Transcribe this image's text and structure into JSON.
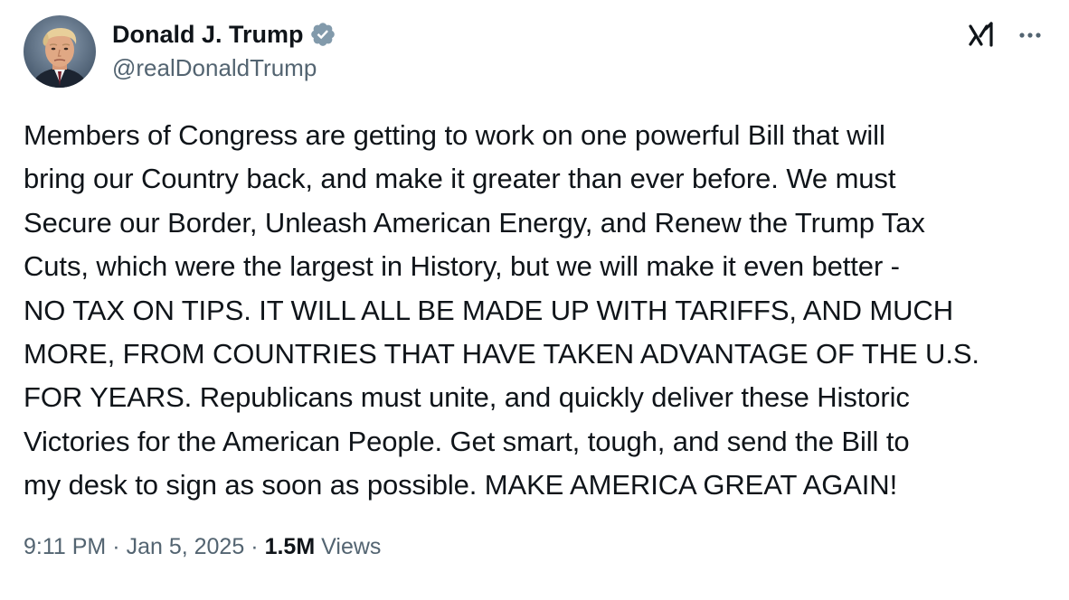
{
  "author": {
    "display_name": "Donald J. Trump",
    "handle": "@realDonaldTrump",
    "verified_badge_color": "#829aab"
  },
  "header_actions": {
    "grok_icon": "grok-icon",
    "more_icon": "more-icon"
  },
  "tweet": {
    "lines": [
      "Members of Congress are getting to work on one powerful Bill that will",
      "bring our Country back, and make it greater than ever before. We must",
      "Secure our Border, Unleash American Energy, and Renew the Trump Tax",
      "Cuts, which were the largest in History, but we will make it even better -",
      "NO TAX ON TIPS. IT WILL ALL BE MADE UP WITH TARIFFS, AND MUCH",
      "MORE, FROM COUNTRIES THAT HAVE TAKEN ADVANTAGE OF THE U.S.",
      "FOR YEARS. Republicans must unite, and quickly deliver these Historic",
      "Victories for the American People. Get smart, tough, and send the Bill to",
      "my desk to sign as soon as possible. MAKE AMERICA GREAT AGAIN!"
    ]
  },
  "meta": {
    "time": "9:11 PM",
    "separator": "·",
    "date": "Jan 5, 2025",
    "views_count": "1.5M",
    "views_label": "Views"
  },
  "colors": {
    "text_primary": "#0f1419",
    "text_secondary": "#536471"
  }
}
